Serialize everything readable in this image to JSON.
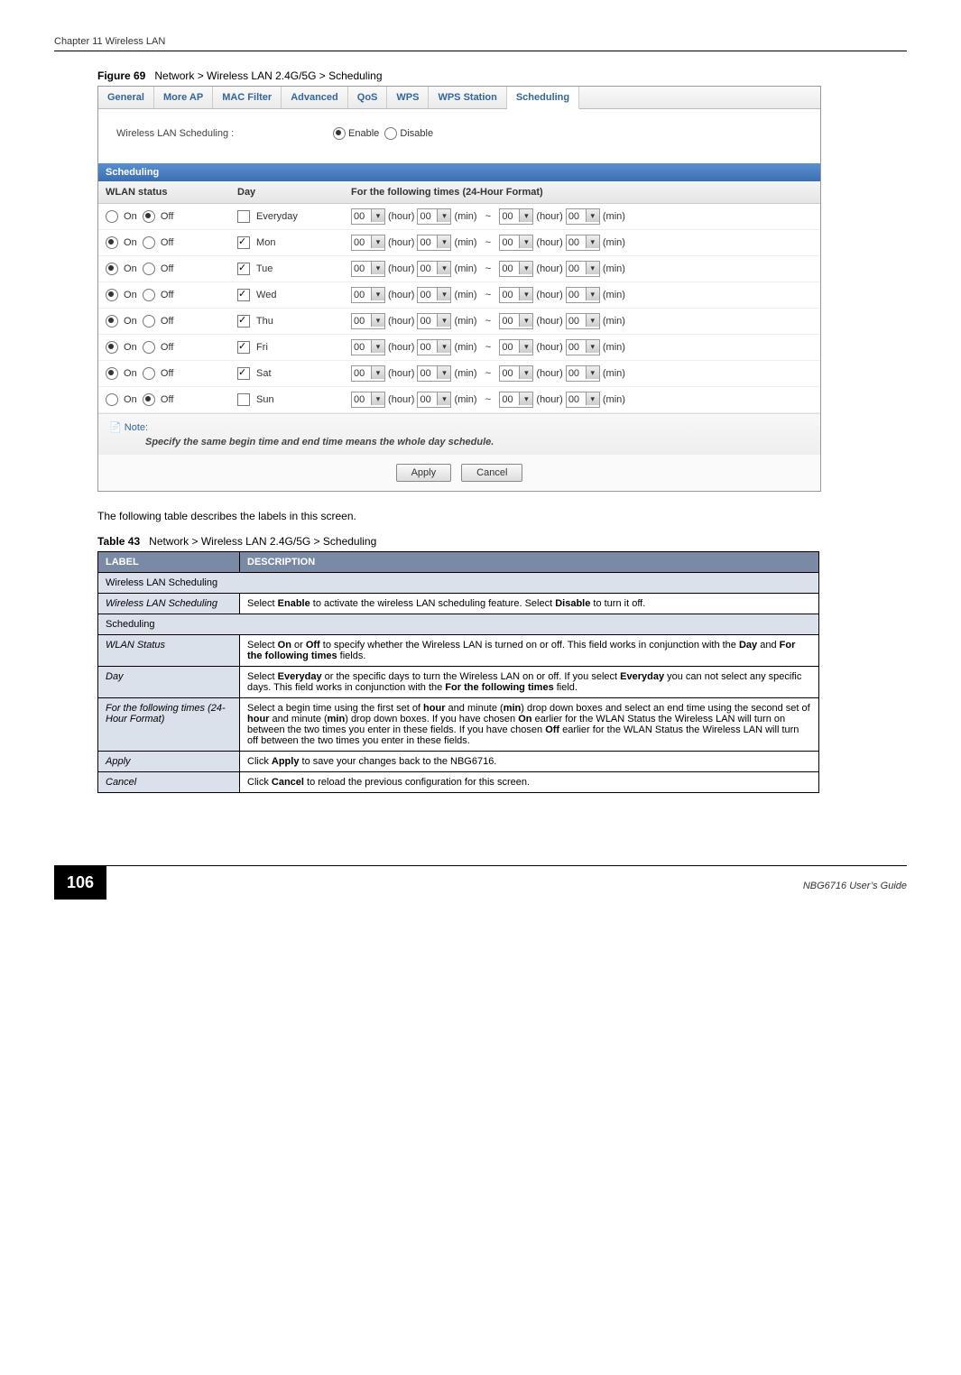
{
  "header": {
    "chapter": "Chapter 11 Wireless LAN"
  },
  "figure": {
    "label": "Figure 69",
    "caption": "Network > Wireless LAN 2.4G/5G > Scheduling"
  },
  "screenshot": {
    "tabs": [
      "General",
      "More AP",
      "MAC Filter",
      "Advanced",
      "QoS",
      "WPS",
      "WPS Station",
      "Scheduling"
    ],
    "active_tab": "Scheduling",
    "setting_label": "Wireless LAN Scheduling :",
    "enable_label": "Enable",
    "disable_label": "Disable",
    "section_title": "Scheduling",
    "columns": {
      "status": "WLAN status",
      "day": "Day",
      "times": "For the following times (24-Hour Format)"
    },
    "on": "On",
    "off": "Off",
    "hour_unit": "(hour)",
    "min_unit": "(min)",
    "tilde": "~",
    "zero": "00",
    "rows": [
      {
        "on": false,
        "day": "Everyday",
        "checked": false
      },
      {
        "on": true,
        "day": "Mon",
        "checked": true
      },
      {
        "on": true,
        "day": "Tue",
        "checked": true
      },
      {
        "on": true,
        "day": "Wed",
        "checked": true
      },
      {
        "on": true,
        "day": "Thu",
        "checked": true
      },
      {
        "on": true,
        "day": "Fri",
        "checked": true
      },
      {
        "on": true,
        "day": "Sat",
        "checked": true
      },
      {
        "on": false,
        "day": "Sun",
        "checked": false
      }
    ],
    "note_title": "Note:",
    "note_text": "Specify the same begin time and end time means the whole day schedule.",
    "apply": "Apply",
    "cancel": "Cancel"
  },
  "body_para": "The following table describes the labels in this screen.",
  "table": {
    "label": "Table 43",
    "caption": "Network > Wireless LAN 2.4G/5G > Scheduling",
    "head_label": "LABEL",
    "head_desc": "DESCRIPTION",
    "rows": [
      {
        "type": "section",
        "text": "Wireless LAN Scheduling"
      },
      {
        "type": "row",
        "label": "Wireless LAN Scheduling",
        "desc_html": "Select <b>Enable</b> to activate the wireless LAN scheduling feature. Select <b>Disable</b> to turn it off."
      },
      {
        "type": "section",
        "text": "Scheduling"
      },
      {
        "type": "row",
        "label": "WLAN Status",
        "desc_html": "Select <b>On</b> or <b>Off</b> to specify whether the Wireless LAN is turned on or off. This field works in conjunction with the <b>Day</b> and <b>For the following times</b> fields."
      },
      {
        "type": "row",
        "label": "Day",
        "desc_html": "Select <b>Everyday</b> or the specific days to turn the Wireless LAN on or off. If you select <b>Everyday</b> you can not select any specific days. This field works in conjunction with the <b>For the following times</b> field."
      },
      {
        "type": "row",
        "label": "For the following times (24-Hour Format)",
        "desc_html": "Select a begin time using the first set of <b>hour</b> and minute (<b>min</b>) drop down boxes and select an end time using the second set of <b>hour</b> and minute (<b>min</b>) drop down boxes. If you have chosen <b>On</b> earlier for the WLAN Status the Wireless LAN will turn on between the two times you enter in these fields. If you have chosen <b>Off</b> earlier for the WLAN Status the Wireless LAN will turn off between the two times you enter in these fields."
      },
      {
        "type": "row",
        "label": "Apply",
        "desc_html": "Click <b>Apply</b> to save your changes back to the NBG6716."
      },
      {
        "type": "row",
        "label": "Cancel",
        "desc_html": "Click <b>Cancel</b> to reload the previous configuration for this screen."
      }
    ]
  },
  "footer": {
    "page": "106",
    "guide": "NBG6716 User’s Guide"
  }
}
